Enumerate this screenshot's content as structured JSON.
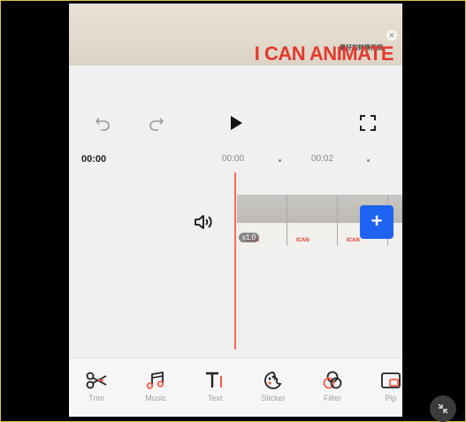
{
  "preview": {
    "banner_text": "I CAN ANIMATE",
    "banner_small": "最好的转换视频"
  },
  "timeline": {
    "current_time": "00:00",
    "ruler_marks": [
      "00:00",
      "00:02"
    ],
    "clip_speed": "x1.0"
  },
  "toolbar": {
    "items": [
      {
        "label": "Trim",
        "icon": "scissors-icon"
      },
      {
        "label": "Music",
        "icon": "music-note-icon"
      },
      {
        "label": "Text",
        "icon": "text-icon"
      },
      {
        "label": "Sticker",
        "icon": "sticker-icon"
      },
      {
        "label": "Filter",
        "icon": "filter-icon"
      },
      {
        "label": "Pip",
        "icon": "pip-icon"
      }
    ]
  },
  "colors": {
    "accent_blue": "#1f63f2",
    "playhead": "#ff6a5a",
    "banner_red": "#e23a2d"
  }
}
